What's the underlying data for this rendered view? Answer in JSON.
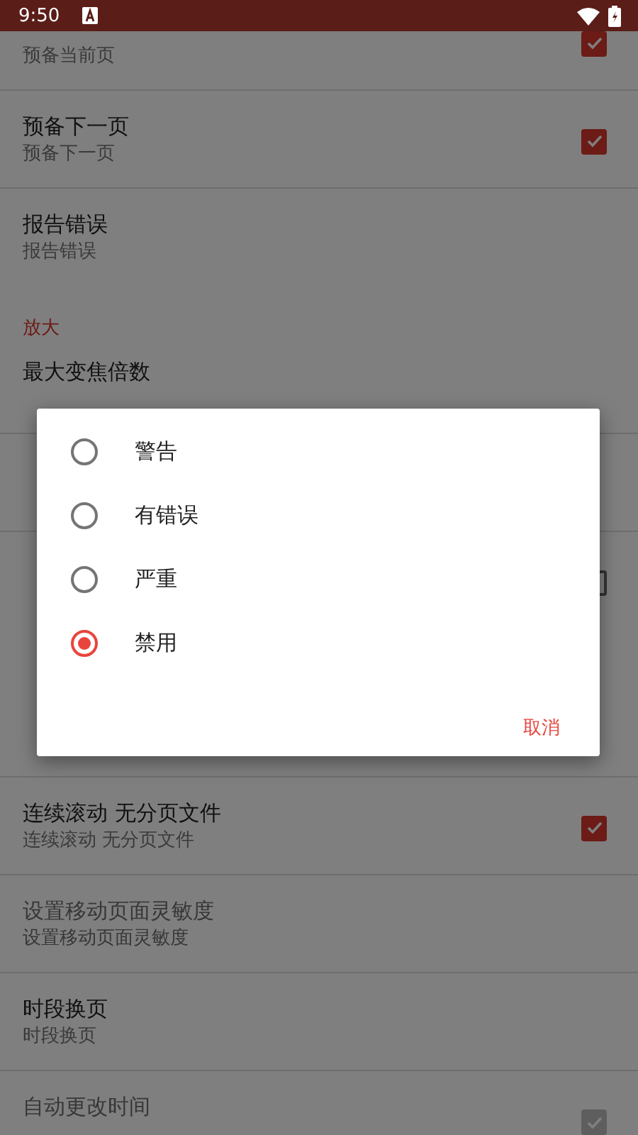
{
  "status_bar": {
    "time": "9:50"
  },
  "settings": [
    {
      "kind": "pref",
      "subtitle": "预备当前页",
      "checkbox": true,
      "checked": true,
      "disabled": false
    },
    {
      "kind": "pref",
      "title": "预备下一页",
      "subtitle": "预备下一页",
      "checkbox": true,
      "checked": true,
      "disabled": false
    },
    {
      "kind": "pref",
      "title": "报告错误",
      "subtitle": "报告错误",
      "disabled": false
    },
    {
      "kind": "section",
      "title": "放大"
    },
    {
      "kind": "pref",
      "title": "最大变焦倍数",
      "disabled": false
    },
    {
      "kind": "pref"
    },
    {
      "kind": "pref",
      "checkbox": true,
      "checked": false,
      "disabled": false
    },
    {
      "kind": "section"
    },
    {
      "kind": "pref"
    },
    {
      "kind": "pref",
      "title": "连续滚动 无分页文件",
      "subtitle": "连续滚动 无分页文件",
      "checkbox": true,
      "checked": true,
      "disabled": false
    },
    {
      "kind": "pref",
      "title": "设置移动页面灵敏度",
      "subtitle": "设置移动页面灵敏度",
      "disabled": true
    },
    {
      "kind": "pref",
      "title": "时段换页",
      "subtitle": "时段换页",
      "disabled": false
    },
    {
      "kind": "pref",
      "title": "自动更改时间",
      "checkbox": true,
      "checked": true,
      "disabled": true
    }
  ],
  "dialog": {
    "options": [
      {
        "label": "警告",
        "selected": false
      },
      {
        "label": "有错误",
        "selected": false
      },
      {
        "label": "严重",
        "selected": false
      },
      {
        "label": "禁用",
        "selected": true
      }
    ],
    "cancel": "取消"
  }
}
